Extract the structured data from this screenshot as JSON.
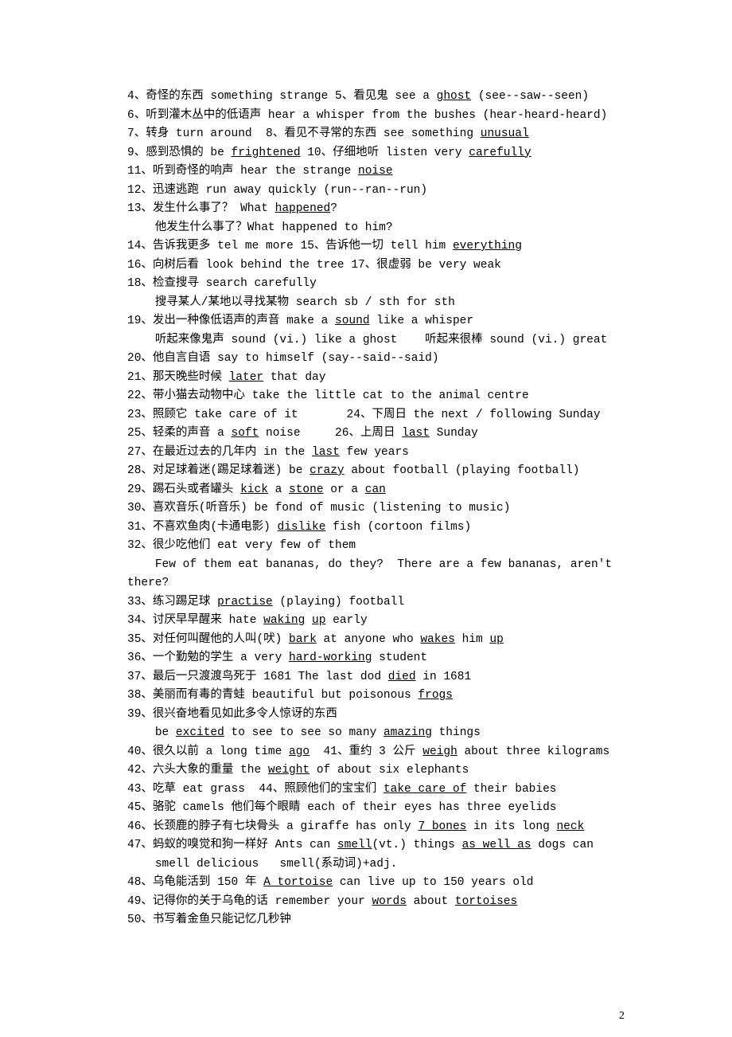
{
  "lines": [
    [
      {
        "t": "4、奇怪的东西 something strange 5、看见鬼 see a "
      },
      {
        "t": "ghost",
        "u": 1
      },
      {
        "t": " (see--saw--seen)"
      }
    ],
    [
      {
        "t": "6、听到灌木丛中的低语声 hear a whisper from the bushes (hear-heard-heard)"
      }
    ],
    [
      {
        "t": "7、转身 turn around  8、看见不寻常的东西 see something "
      },
      {
        "t": "unusual",
        "u": 1
      }
    ],
    [
      {
        "t": "9、感到恐惧的 be "
      },
      {
        "t": "frightened",
        "u": 1
      },
      {
        "t": " 10、仔细地听 listen very "
      },
      {
        "t": "carefully",
        "u": 1
      }
    ],
    [
      {
        "t": "11、听到奇怪的响声 hear the strange "
      },
      {
        "t": "noise",
        "u": 1
      }
    ],
    [
      {
        "t": "12、迅速逃跑 run away quickly (run--ran--run)"
      }
    ],
    [
      {
        "t": "13、发生什么事了？ What "
      },
      {
        "t": "happened",
        "u": 1
      },
      {
        "t": "?"
      }
    ],
    [
      {
        "t": "    他发生什么事了？What happened to him?"
      }
    ],
    [
      {
        "t": "14、告诉我更多 tel me more 15、告诉他一切 tell him "
      },
      {
        "t": "everything",
        "u": 1
      }
    ],
    [
      {
        "t": "16、向树后看 look behind the tree 17、很虚弱 be very weak"
      }
    ],
    [
      {
        "t": "18、检查搜寻 search carefully"
      }
    ],
    [
      {
        "t": "    搜寻某人/某地以寻找某物 search sb / sth for sth"
      }
    ],
    [
      {
        "t": "19、发出一种像低语声的声音 make a "
      },
      {
        "t": "sound",
        "u": 1
      },
      {
        "t": " like a whisper"
      }
    ],
    [
      {
        "t": "    听起来像鬼声 sound (vi.) like a ghost    听起来很棒 sound (vi.) great"
      }
    ],
    [
      {
        "t": "20、他自言自语 say to himself (say--said--said)"
      }
    ],
    [
      {
        "t": "21、那天晚些时候 "
      },
      {
        "t": "later",
        "u": 1
      },
      {
        "t": " that day"
      }
    ],
    [
      {
        "t": "22、带小猫去动物中心 take the little cat to the animal centre"
      }
    ],
    [
      {
        "t": "23、照顾它 take care of it       24、下周日 the next / following Sunday"
      }
    ],
    [
      {
        "t": "25、轻柔的声音 a "
      },
      {
        "t": "soft",
        "u": 1
      },
      {
        "t": " noise     26、上周日 "
      },
      {
        "t": "last",
        "u": 1
      },
      {
        "t": " Sunday"
      }
    ],
    [
      {
        "t": "27、在最近过去的几年内 in the "
      },
      {
        "t": "last",
        "u": 1
      },
      {
        "t": " few years"
      }
    ],
    [
      {
        "t": "28、对足球着迷(踢足球着迷) be "
      },
      {
        "t": "crazy",
        "u": 1
      },
      {
        "t": " about football (playing football)"
      }
    ],
    [
      {
        "t": "29、踢石头或者罐头 "
      },
      {
        "t": "kick",
        "u": 1
      },
      {
        "t": " a "
      },
      {
        "t": "stone",
        "u": 1
      },
      {
        "t": " or a "
      },
      {
        "t": "can",
        "u": 1
      }
    ],
    [
      {
        "t": "30、喜欢音乐(听音乐) be fond of music (listening to music)"
      }
    ],
    [
      {
        "t": "31、不喜欢鱼肉(卡通电影) "
      },
      {
        "t": "dislike",
        "u": 1
      },
      {
        "t": " fish (cortoon films)"
      }
    ],
    [
      {
        "t": "32、很少吃他们 eat very few of them"
      }
    ],
    [
      {
        "t": "    Few of them eat bananas, do they?  There are a few bananas, aren't there?"
      }
    ],
    [
      {
        "t": "33、练习踢足球 "
      },
      {
        "t": "practise",
        "u": 1
      },
      {
        "t": " (playing) football"
      }
    ],
    [
      {
        "t": "34、讨厌早早醒来 hate "
      },
      {
        "t": "waking",
        "u": 1
      },
      {
        "t": " "
      },
      {
        "t": "up",
        "u": 1
      },
      {
        "t": " early"
      }
    ],
    [
      {
        "t": "35、对任何叫醒他的人叫(吠) "
      },
      {
        "t": "bark",
        "u": 1
      },
      {
        "t": " at anyone who "
      },
      {
        "t": "wakes",
        "u": 1
      },
      {
        "t": " him "
      },
      {
        "t": "up",
        "u": 1
      }
    ],
    [
      {
        "t": "36、一个勤勉的学生 a very "
      },
      {
        "t": "hard-working",
        "u": 1
      },
      {
        "t": " student"
      }
    ],
    [
      {
        "t": "37、最后一只渡渡鸟死于 1681 The last dod "
      },
      {
        "t": "died",
        "u": 1
      },
      {
        "t": " in 1681"
      }
    ],
    [
      {
        "t": "38、美丽而有毒的青蛙 beautiful but poisonous "
      },
      {
        "t": "frogs",
        "u": 1
      }
    ],
    [
      {
        "t": "39、很兴奋地看见如此多令人惊讶的东西"
      }
    ],
    [
      {
        "t": "    be "
      },
      {
        "t": "excited",
        "u": 1
      },
      {
        "t": " to see to see so many "
      },
      {
        "t": "amazing",
        "u": 1
      },
      {
        "t": " things"
      }
    ],
    [
      {
        "t": "40、很久以前 a long time "
      },
      {
        "t": "ago",
        "u": 1
      },
      {
        "t": "  41、重约 3 公斤 "
      },
      {
        "t": "weigh",
        "u": 1
      },
      {
        "t": " about three kilograms"
      }
    ],
    [
      {
        "t": "42、六头大象的重量 the "
      },
      {
        "t": "weight",
        "u": 1
      },
      {
        "t": " of about six elephants"
      }
    ],
    [
      {
        "t": "43、吃草 eat grass  44、照顾他们的宝宝们 "
      },
      {
        "t": "take care of",
        "u": 1
      },
      {
        "t": " their babies"
      }
    ],
    [
      {
        "t": "45、骆驼 camels 他们每个眼睛 each of their eyes has three eyelids"
      }
    ],
    [
      {
        "t": "46、长颈鹿的脖子有七块骨头 a giraffe has only "
      },
      {
        "t": "7 bones",
        "u": 1
      },
      {
        "t": " in its long "
      },
      {
        "t": "neck",
        "u": 1
      }
    ],
    [
      {
        "t": "47、蚂蚁的嗅觉和狗一样好 Ants can "
      },
      {
        "t": "smell",
        "u": 1
      },
      {
        "t": "(vt.) things "
      },
      {
        "t": "as well as",
        "u": 1
      },
      {
        "t": " dogs can"
      }
    ],
    [
      {
        "t": "    smell delicious   smell(系动词)+adj."
      }
    ],
    [
      {
        "t": "48、乌龟能活到 150 年 "
      },
      {
        "t": "A tortoise",
        "u": 1
      },
      {
        "t": " can live up to 150 years old"
      }
    ],
    [
      {
        "t": "49、记得你的关于乌龟的话 remember your "
      },
      {
        "t": "words",
        "u": 1
      },
      {
        "t": " about "
      },
      {
        "t": "tortoises",
        "u": 1
      }
    ],
    [
      {
        "t": "50、书写着金鱼只能记忆几秒钟"
      }
    ]
  ],
  "page_number": "2"
}
